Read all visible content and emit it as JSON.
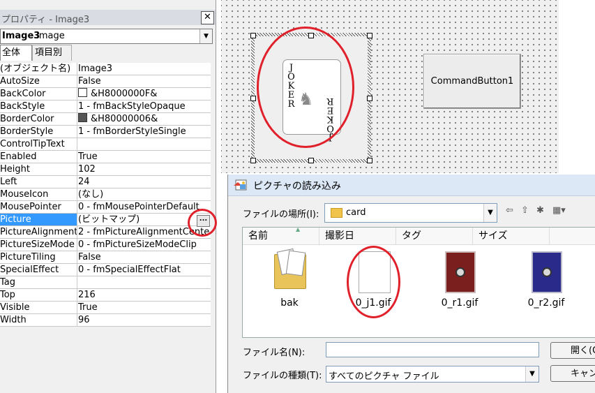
{
  "properties": {
    "title": "プロパティ - Image3",
    "close": "✕",
    "object_combo": {
      "name": "Image3",
      "type": "Image"
    },
    "tabs": [
      "全体",
      "項目別"
    ],
    "rows": [
      {
        "name": "(オブジェクト名)",
        "value": "Image3"
      },
      {
        "name": "AutoSize",
        "value": "False"
      },
      {
        "name": "BackColor",
        "value": "&H8000000F&",
        "swatch": "#ffffff"
      },
      {
        "name": "BackStyle",
        "value": "1 - fmBackStyleOpaque"
      },
      {
        "name": "BorderColor",
        "value": "&H80000006&",
        "swatch": "#555555"
      },
      {
        "name": "BorderStyle",
        "value": "1 - fmBorderStyleSingle"
      },
      {
        "name": "ControlTipText",
        "value": ""
      },
      {
        "name": "Enabled",
        "value": "True"
      },
      {
        "name": "Height",
        "value": "102"
      },
      {
        "name": "Left",
        "value": "24"
      },
      {
        "name": "MouseIcon",
        "value": "(なし)"
      },
      {
        "name": "MousePointer",
        "value": "0 - fmMousePointerDefault"
      },
      {
        "name": "Picture",
        "value": "(ビットマップ)"
      },
      {
        "name": "PictureAlignment",
        "value": "2 - fmPictureAlignmentCente"
      },
      {
        "name": "PictureSizeMode",
        "value": "0 - fmPictureSizeModeClip"
      },
      {
        "name": "PictureTiling",
        "value": "False"
      },
      {
        "name": "SpecialEffect",
        "value": "0 - fmSpecialEffectFlat"
      },
      {
        "name": "Tag",
        "value": ""
      },
      {
        "name": "Top",
        "value": "216"
      },
      {
        "name": "Visible",
        "value": "True"
      },
      {
        "name": "Width",
        "value": "96"
      }
    ],
    "selected_row": "Picture",
    "ellipsis": "...",
    "selection_color": "#3399ff"
  },
  "designer": {
    "joker_text": "JOKER",
    "joker_figure": "♞",
    "command_button": "CommandButton1"
  },
  "dialog": {
    "title": "ピクチャの読み込み",
    "look_in_label": "ファイルの場所(I):",
    "look_in_value": "card",
    "toolbar_icons": [
      "back-arrow-icon",
      "up-folder-icon",
      "new-folder-icon",
      "view-menu-icon"
    ],
    "toolbar_glyphs": [
      "⇦",
      "⇧",
      "✱",
      "▦▾"
    ],
    "columns": [
      "名前",
      "撮影日",
      "タグ",
      "サイズ"
    ],
    "files": [
      {
        "name": "bak",
        "kind": "folder"
      },
      {
        "name": "0_j1.gif",
        "kind": "joker"
      },
      {
        "name": "0_r1.gif",
        "kind": "red"
      },
      {
        "name": "0_r2.gif",
        "kind": "blue"
      }
    ],
    "filename_label": "ファイル名(N):",
    "filename_value": "",
    "filetype_label": "ファイルの種類(T):",
    "filetype_value": "すべてのピクチャ ファイル",
    "open_button": "開く(O",
    "cancel_button": "キャンセル"
  },
  "highlight_color": "#e0202a"
}
